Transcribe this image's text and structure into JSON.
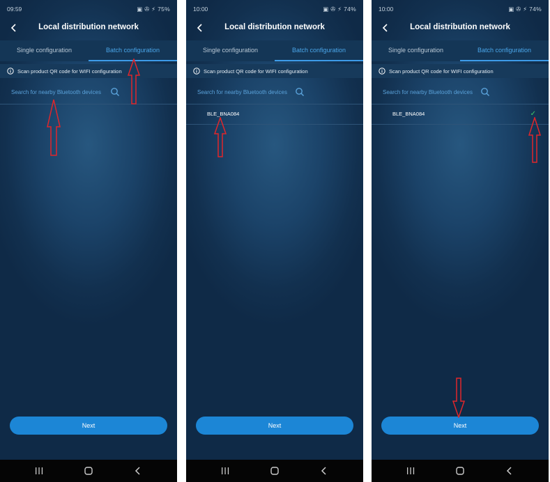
{
  "common": {
    "title": "Local distribution network",
    "tabs": [
      "Single configuration",
      "Batch configuration"
    ],
    "qr_text": "Scan product QR code for WIFI configuration",
    "search_text": "Search for nearby Bluetooth devices",
    "next_label": "Next"
  },
  "screens": [
    {
      "status_time": "09:59",
      "status_right": "▣ ✇ ⚡ 75%"
    },
    {
      "status_time": "10:00",
      "status_right": "▣ ✇ ⚡ 74%"
    },
    {
      "status_time": "10:00",
      "status_right": "▣ ✇ ⚡ 74%"
    }
  ],
  "device": {
    "name": "BLE_BNA084",
    "check": "✓"
  },
  "icons": [
    "back-icon",
    "info-icon",
    "search-icon",
    "check-icon",
    "recent-apps-icon",
    "home-icon",
    "nav-back-icon",
    "arrow-annotation"
  ],
  "colors": {
    "background": "#1b4369",
    "accent": "#3d9be8",
    "button": "#1c86d6",
    "check": "#3fcf6b",
    "annotation": "#e0262b"
  }
}
